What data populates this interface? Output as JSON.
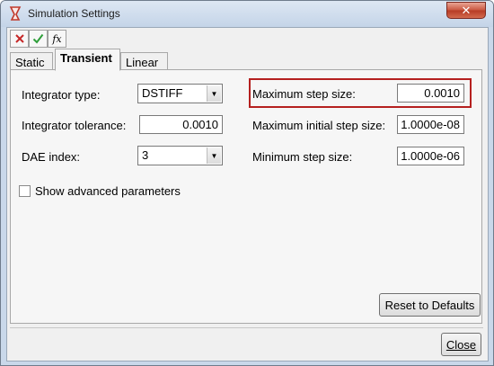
{
  "window": {
    "title": "Simulation Settings",
    "close_glyph": "✕"
  },
  "toolbar": {
    "icons": [
      "close-icon",
      "check-icon",
      "function-icon"
    ],
    "fx_label": "fx"
  },
  "tabs": [
    {
      "label": "Static",
      "active": false
    },
    {
      "label": "Transient",
      "active": true
    },
    {
      "label": "Linear",
      "active": false
    }
  ],
  "left_fields": {
    "integrator_type": {
      "label": "Integrator type:",
      "value": "DSTIFF"
    },
    "integrator_tolerance": {
      "label": "Integrator tolerance:",
      "value": "0.0010"
    },
    "dae_index": {
      "label": "DAE index:",
      "value": "3"
    }
  },
  "right_fields": {
    "max_step": {
      "label": "Maximum step size:",
      "value": "0.0010"
    },
    "max_initial_step": {
      "label": "Maximum initial step size:",
      "value": "1.0000e-08"
    },
    "min_step": {
      "label": "Minimum step size:",
      "value": "1.0000e-06"
    }
  },
  "show_advanced": {
    "label": "Show advanced parameters",
    "checked": false
  },
  "buttons": {
    "reset": "Reset to Defaults",
    "close": "Close"
  },
  "colors": {
    "highlight": "#b5201f",
    "titlebar": "#c9d8ea"
  }
}
